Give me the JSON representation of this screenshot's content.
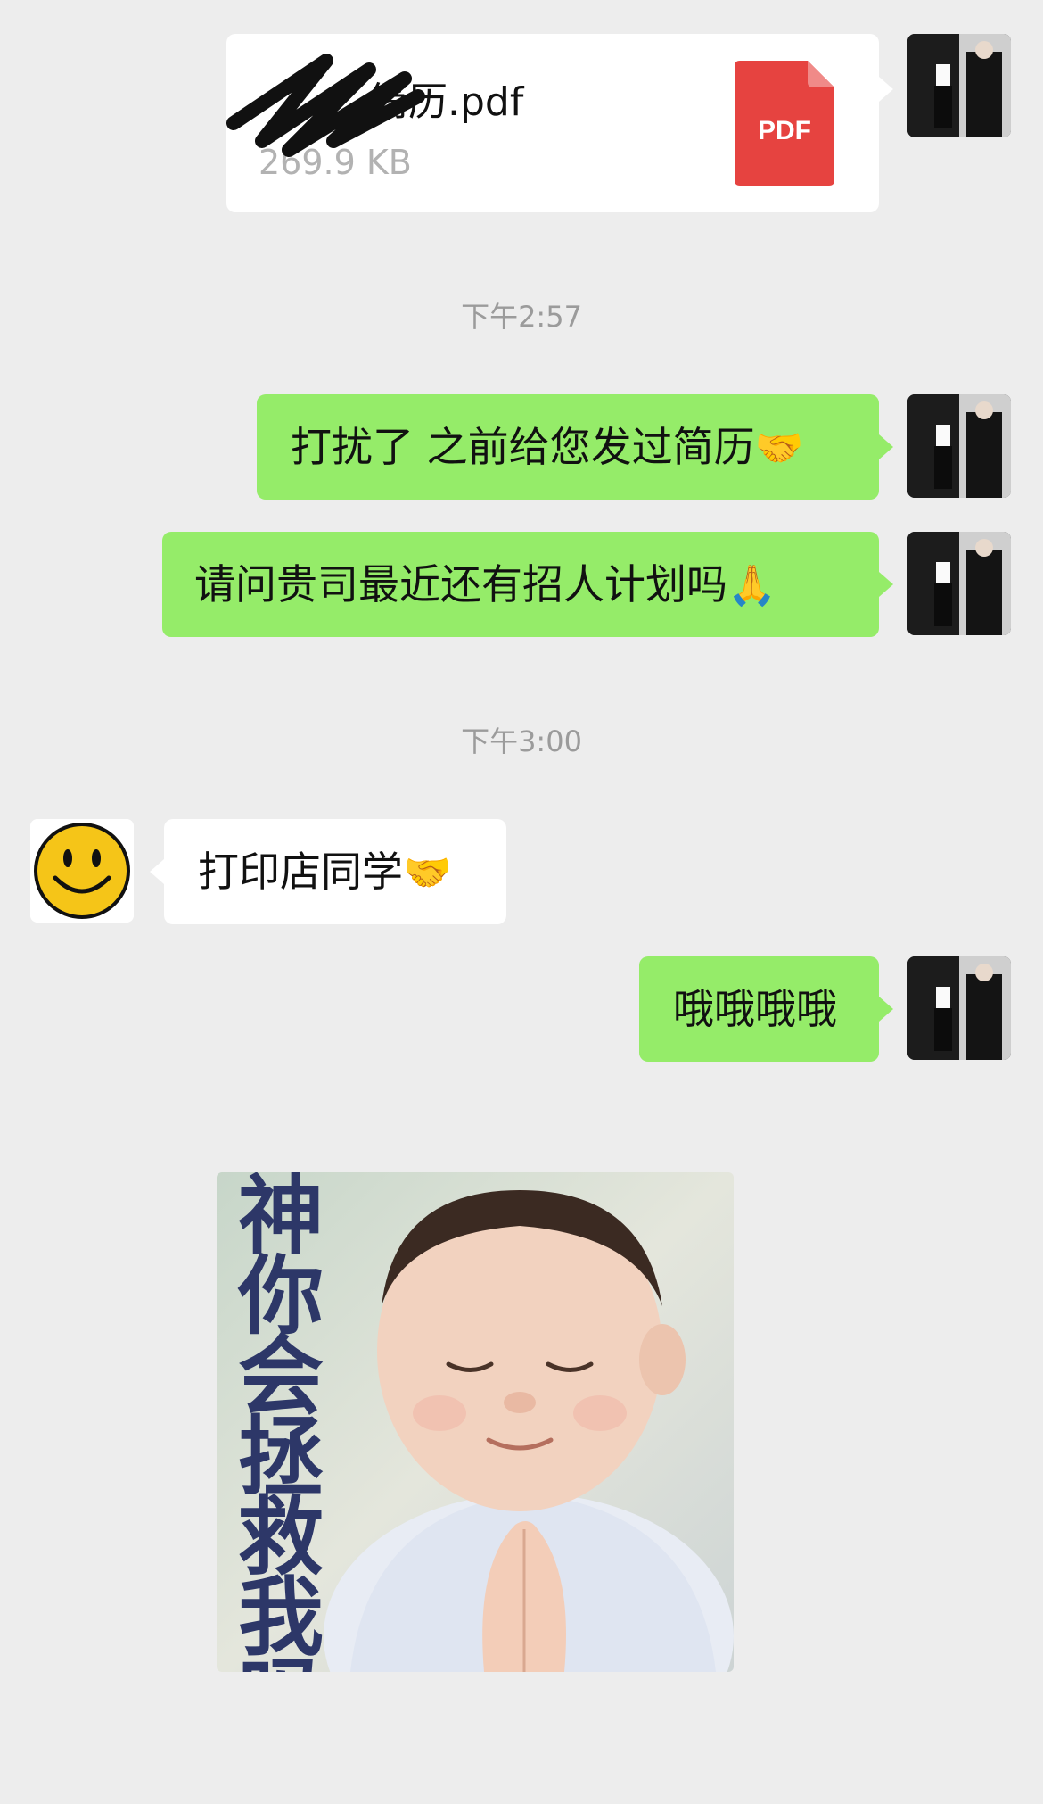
{
  "messages": {
    "file": {
      "name": "简历.pdf",
      "size": "269.9 KB",
      "icon_label": "PDF"
    },
    "time_1": "下午2:57",
    "me_1": {
      "text": "打扰了 之前给您发过简历",
      "emoji": "🤝"
    },
    "me_2": {
      "text": "请问贵司最近还有招人计划吗",
      "emoji": "🙏"
    },
    "time_2": "下午3:00",
    "them_1": {
      "text": "打印店同学",
      "emoji": "🤝"
    },
    "me_3": {
      "text": "哦哦哦哦"
    },
    "sticker": {
      "chars": [
        "神",
        "你",
        "会",
        "拯",
        "救",
        "我",
        "吗"
      ]
    }
  },
  "colors": {
    "background": "#ededed",
    "my_bubble": "#95ec69",
    "their_bubble": "#ffffff",
    "pdf_red": "#e64340",
    "time_text": "#9b9b9b"
  }
}
